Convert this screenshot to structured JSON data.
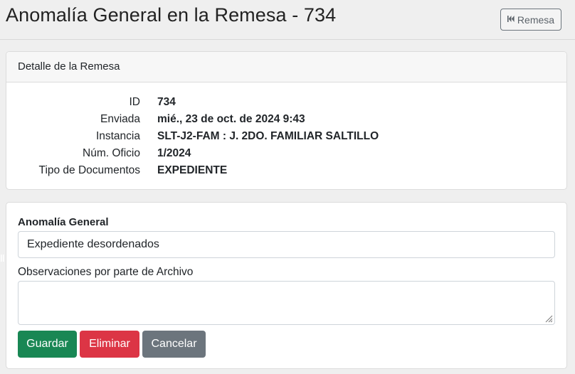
{
  "header": {
    "title": "Anomalía General en la Remesa - 734",
    "back_button": {
      "icon": "skip-back-icon",
      "label": "Remesa"
    }
  },
  "detail_card": {
    "title": "Detalle de la Remesa",
    "rows": [
      {
        "label": "ID",
        "value": "734"
      },
      {
        "label": "Enviada",
        "value": "mié., 23 de oct. de 2024 9:43"
      },
      {
        "label": "Instancia",
        "value": "SLT-J2-FAM : J. 2DO. FAMILIAR SALTILLO"
      },
      {
        "label": "Núm. Oficio",
        "value": "1/2024"
      },
      {
        "label": "Tipo de Documentos",
        "value": "EXPEDIENTE"
      }
    ]
  },
  "form": {
    "anomaly_label": "Anomalía General",
    "anomaly_value": "Expediente desordenados",
    "observations_label": "Observaciones por parte de Archivo",
    "observations_value": "",
    "buttons": {
      "save": "Guardar",
      "delete": "Eliminar",
      "cancel": "Cancelar"
    }
  },
  "colors": {
    "save": "#198754",
    "delete": "#dc3545",
    "cancel": "#6c757d",
    "background": "#efefef"
  }
}
